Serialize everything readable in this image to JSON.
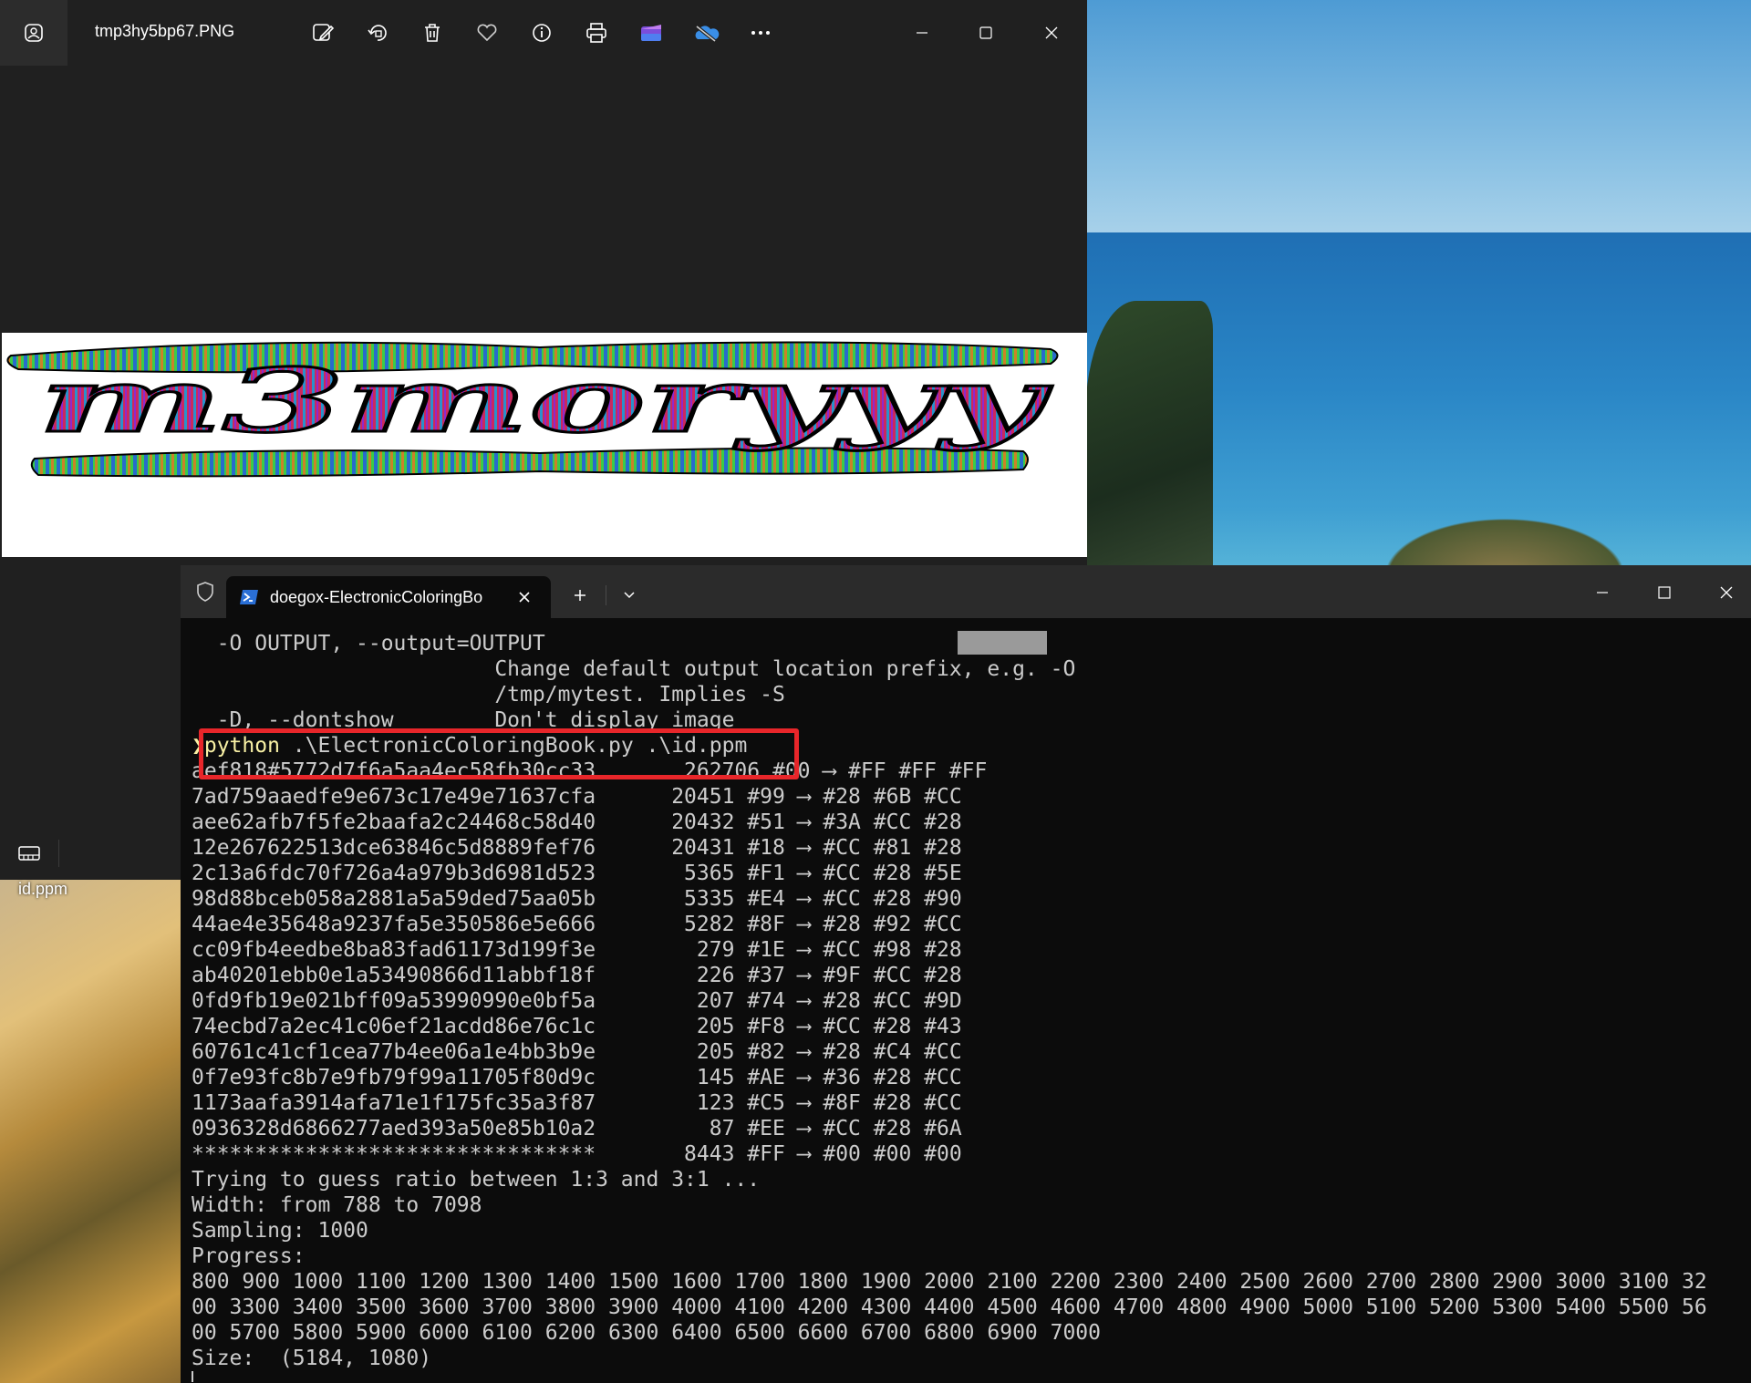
{
  "photos_window": {
    "title": "tmp3hy5bp67.PNG",
    "toolbar_icons": [
      "edit-image-icon",
      "rotate-icon",
      "delete-icon",
      "favorite-icon",
      "info-icon",
      "print-icon",
      "clipchamp-icon",
      "onedrive-icon",
      "more-icon"
    ],
    "image_text": "m3moryyy"
  },
  "desktop": {
    "icon_label": "id.ppm"
  },
  "terminal": {
    "tab_title": "doegox-ElectronicColoringBo",
    "lines": [
      "  -O OUTPUT, --output=OUTPUT",
      "                        Change default output location prefix, e.g. -O",
      "                        /tmp/mytest. Implies -S",
      "  -D, --dontshow        Don't display image",
      " ",
      "aef818#5772d7f6a5aa4ec58fb30cc33       262706 #00 ⟶ #FF #FF #FF",
      "7ad759aaedfe9e673c17e49e71637cfa      20451 #99 ⟶ #28 #6B #CC",
      "aee62afb7f5fe2baafa2c24468c58d40      20432 #51 ⟶ #3A #CC #28",
      "12e267622513dce63846c5d8889fef76      20431 #18 ⟶ #CC #81 #28",
      "2c13a6fdc70f726a4a979b3d6981d523       5365 #F1 ⟶ #CC #28 #5E",
      "98d88bceb058a2881a5a59ded75aa05b       5335 #E4 ⟶ #CC #28 #90",
      "44ae4e35648a9237fa5e350586e5e666       5282 #8F ⟶ #28 #92 #CC",
      "cc09fb4eedbe8ba83fad61173d199f3e        279 #1E ⟶ #CC #98 #28",
      "ab40201ebb0e1a53490866d11abbf18f        226 #37 ⟶ #9F #CC #28",
      "0fd9fb19e021bff09a53990990e0bf5a        207 #74 ⟶ #28 #CC #9D",
      "74ecbd7a2ec41c06ef21acdd86e76c1c        205 #F8 ⟶ #CC #28 #43",
      "60761c41cf1cea77b4ee06a1e4bb3b9e        205 #82 ⟶ #28 #C4 #CC",
      "0f7e93fc8b7e9fb79f99a11705f80d9c        145 #AE ⟶ #36 #28 #CC",
      "1173aafa3914afa71e1f175fc35a3f87        123 #C5 ⟶ #8F #28 #CC",
      "0936328d6866277aed393a50e85b10a2         87 #EE ⟶ #CC #28 #6A",
      "********************************       8443 #FF ⟶ #00 #00 #00",
      "Trying to guess ratio between 1:3 and 3:1 ...",
      "Width: from 788 to 7098",
      "Sampling: 1000",
      "Progress:",
      "800 900 1000 1100 1200 1300 1400 1500 1600 1700 1800 1900 2000 2100 2200 2300 2400 2500 2600 2700 2800 2900 3000 3100 32",
      "00 3300 3400 3500 3600 3700 3800 3900 4000 4100 4200 4300 4400 4500 4600 4700 4800 4900 5000 5100 5200 5300 5400 5500 56",
      "00 5700 5800 5900 6000 6100 6200 6300 6400 6500 6600 6700 6800 6900 7000",
      "Size:  (5184, 1080)"
    ],
    "command": {
      "prompt": "❯",
      "program": "python",
      "args": " .\\ElectronicColoringBook.py .\\id.ppm"
    }
  }
}
